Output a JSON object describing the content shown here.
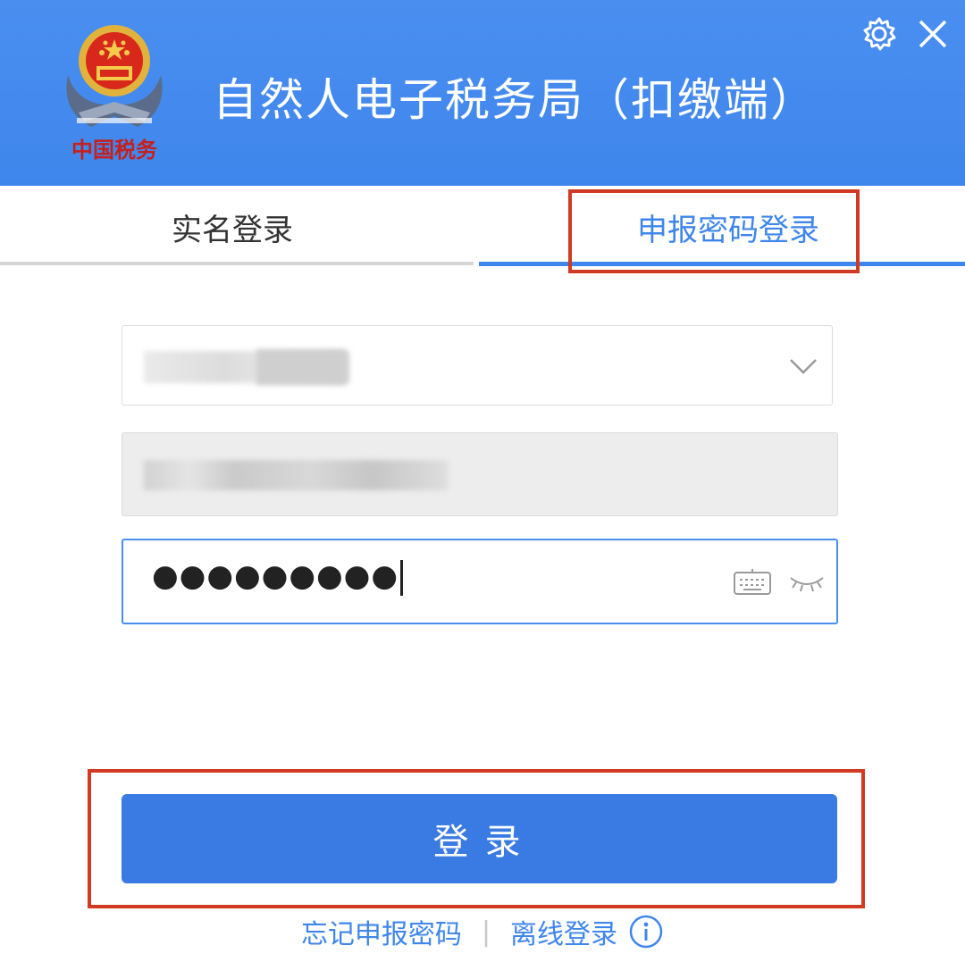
{
  "header": {
    "title": "自然人电子税务局（扣缴端）",
    "logo_text": "中国税务",
    "emblem_icon": "national-emblem",
    "settings_icon": "gear-icon",
    "close_icon": "close-icon",
    "background_color": "#4a8ef0"
  },
  "tabs": [
    {
      "label": "实名登录",
      "active": false
    },
    {
      "label": "申报密码登录",
      "active": true
    }
  ],
  "form": {
    "account_value": "",
    "name_value": "",
    "password_value": "●●●●●●●●●",
    "dropdown_icon": "chevron-down-icon",
    "keyboard_icon": "keyboard-icon",
    "visibility_icon": "eye-closed-icon"
  },
  "login_button": {
    "label": "登录"
  },
  "links": {
    "forgot": "忘记申报密码",
    "offline": "离线登录",
    "info_icon": "info-icon"
  },
  "colors": {
    "accent": "#3f86ec",
    "button": "#3a7be3",
    "highlight": "#d13a22"
  }
}
